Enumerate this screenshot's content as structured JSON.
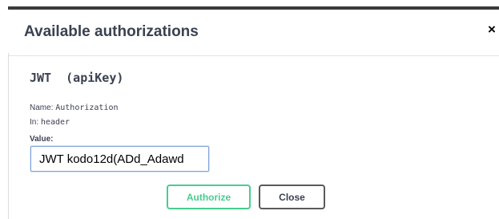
{
  "modal": {
    "title": "Available authorizations",
    "close_glyph": "×"
  },
  "auth": {
    "scheme_title": "JWT  (apiKey)",
    "name_label": "Name:",
    "name_value": "Authorization",
    "in_label": "In:",
    "in_value": "header",
    "value_label": "Value:",
    "value_input": "JWT kodo12d(ADd_Adawd"
  },
  "buttons": {
    "authorize_label": "Authorize",
    "close_label": "Close"
  },
  "colors": {
    "authorize_accent": "#49cc90",
    "text_primary": "#3b4151",
    "header_bar": "#3b3b3b"
  },
  "icons": {
    "close": "close-icon"
  }
}
